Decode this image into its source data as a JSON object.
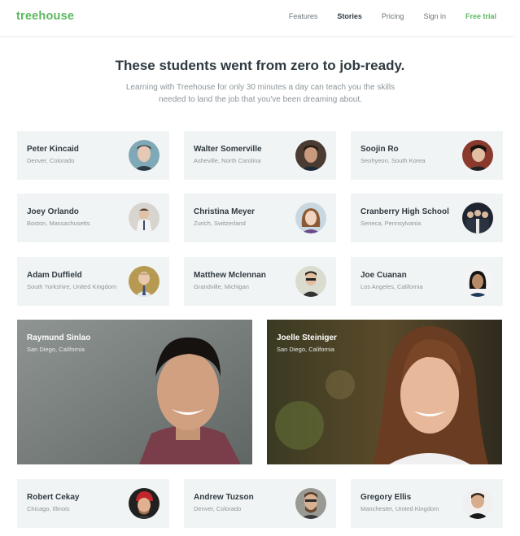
{
  "nav": {
    "logo": "treehouse",
    "links": [
      "Features",
      "Stories",
      "Pricing",
      "Sign in",
      "Free trial"
    ]
  },
  "hero": {
    "title": "These students went from zero to job-ready.",
    "subtitle_line1": "Learning with Treehouse for only 30 minutes a day can teach you the skills",
    "subtitle_line2": "needed to land the job that you've been dreaming about."
  },
  "students": [
    {
      "name": "Peter Kincaid",
      "location": "Denver, Colorado"
    },
    {
      "name": "Walter Somerville",
      "location": "Asheville, North Carolina"
    },
    {
      "name": "Soojin Ro",
      "location": "Seohyeon, South Korea"
    },
    {
      "name": "Joey Orlando",
      "location": "Boston, Massachusetts"
    },
    {
      "name": "Christina Meyer",
      "location": "Zurich, Switzerland"
    },
    {
      "name": "Cranberry High School",
      "location": "Seneca, Pennsylvania"
    },
    {
      "name": "Adam Duffield",
      "location": "South Yorkshire, United Kingdom"
    },
    {
      "name": "Matthew Mclennan",
      "location": "Grandville, Michigan"
    },
    {
      "name": "Joe Cuanan",
      "location": "Los Angeles, California"
    }
  ],
  "featured": [
    {
      "name": "Raymund Sinlao",
      "location": "San Diego, California"
    },
    {
      "name": "Joelle Steiniger",
      "location": "San Diego, California"
    }
  ],
  "students_bottom": [
    {
      "name": "Robert Cekay",
      "location": "Chicago, Illinois"
    },
    {
      "name": "Andrew Tuzson",
      "location": "Denver, Colorado"
    },
    {
      "name": "Gregory Ellis",
      "location": "Manchester, United Kingdom"
    }
  ],
  "colors": {
    "brand_green": "#5cb860",
    "card_bg": "#f1f4f5",
    "text_dark": "#2f3a40",
    "text_muted": "#8d969b"
  }
}
